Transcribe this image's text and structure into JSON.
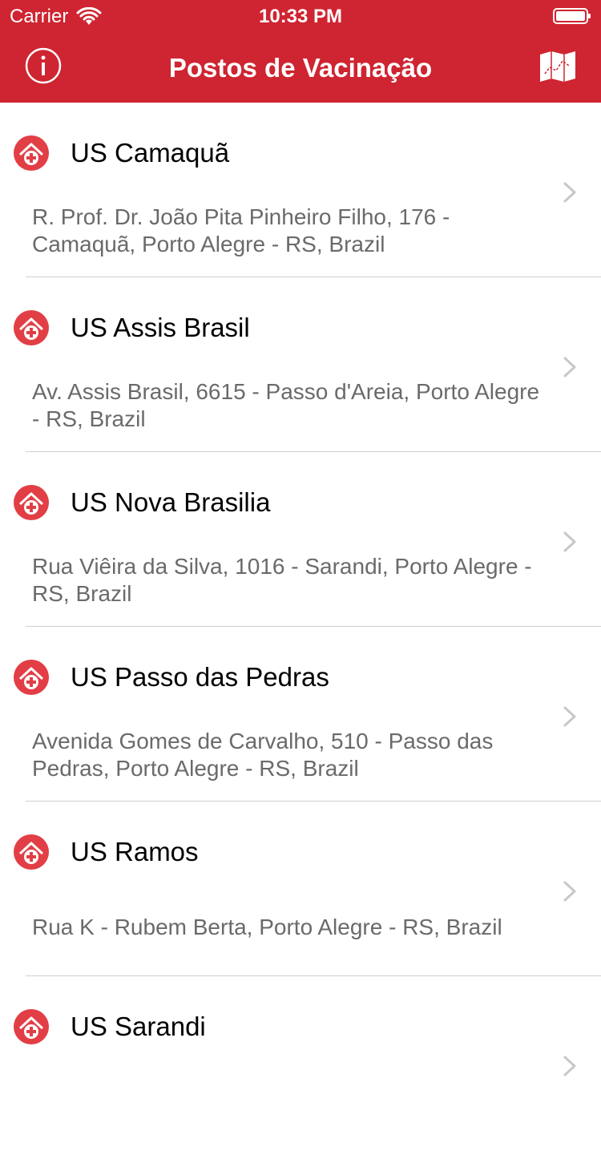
{
  "status_bar": {
    "carrier": "Carrier",
    "time": "10:33 PM"
  },
  "nav": {
    "title": "Postos de Vacinação",
    "left_icon": "info-icon",
    "right_icon": "map-icon"
  },
  "colors": {
    "brand": "#cf2431",
    "pin": "#e23e45",
    "address_text": "#6a6a6a",
    "separator": "#cfcfcf"
  },
  "locations": [
    {
      "name": "US Camaquã",
      "address": "R. Prof. Dr. João Pita Pinheiro Filho, 176 - Camaquã, Porto Alegre - RS, Brazil"
    },
    {
      "name": "US Assis Brasil",
      "address": "Av. Assis Brasil, 6615 - Passo d'Areia, Porto Alegre - RS, Brazil"
    },
    {
      "name": "US Nova Brasilia",
      "address": "Rua Viêira da Silva, 1016 - Sarandi, Porto Alegre - RS, Brazil"
    },
    {
      "name": "US Passo das Pedras",
      "address": "Avenida Gomes de Carvalho, 510 - Passo das Pedras, Porto Alegre - RS, Brazil"
    },
    {
      "name": "US Ramos",
      "address": "Rua K - Rubem Berta, Porto Alegre - RS, Brazil"
    },
    {
      "name": "US Sarandi",
      "address": ""
    }
  ]
}
